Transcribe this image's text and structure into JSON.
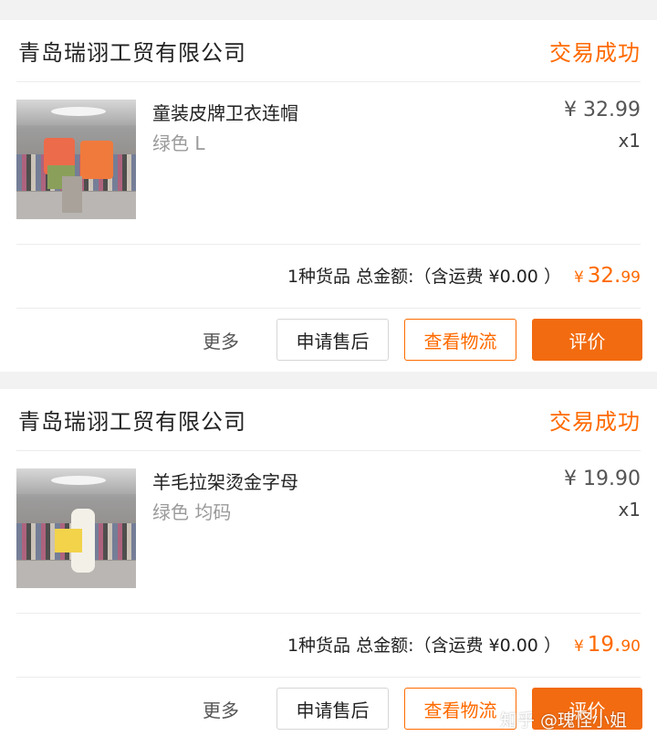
{
  "orders": [
    {
      "shop_name": "青岛瑞诩工贸有限公司",
      "status": "交易成功",
      "item": {
        "thumbnail_icon": "product-photo-kids-hoodie",
        "name": "童装皮牌卫衣连帽",
        "spec": "绿色 L",
        "price": "¥ 32.99",
        "qty": "x1"
      },
      "summary": {
        "text": "1种货品 总金额:（含运费 ¥0.00 ）",
        "amount_symbol": "¥",
        "amount_int": "32.",
        "amount_dec": "99"
      },
      "actions": {
        "more": "更多",
        "after_sale": "申请售后",
        "logistics": "查看物流",
        "review": "评价"
      }
    },
    {
      "shop_name": "青岛瑞诩工贸有限公司",
      "status": "交易成功",
      "item": {
        "thumbnail_icon": "product-photo-wool-letter-sweater",
        "name": "羊毛拉架烫金字母",
        "spec": "绿色 均码",
        "price": "¥ 19.90",
        "qty": "x1"
      },
      "summary": {
        "text": "1种货品 总金额:（含运费 ¥0.00 ）",
        "amount_symbol": "¥",
        "amount_int": "19.",
        "amount_dec": "90"
      },
      "actions": {
        "more": "更多",
        "after_sale": "申请售后",
        "logistics": "查看物流",
        "review": "评价"
      }
    }
  ],
  "watermark": "知乎 @瑰怪小姐",
  "colors": {
    "accent": "#ff6a00",
    "review_button": "#f26b10",
    "page_background": "#f2f2f2"
  }
}
